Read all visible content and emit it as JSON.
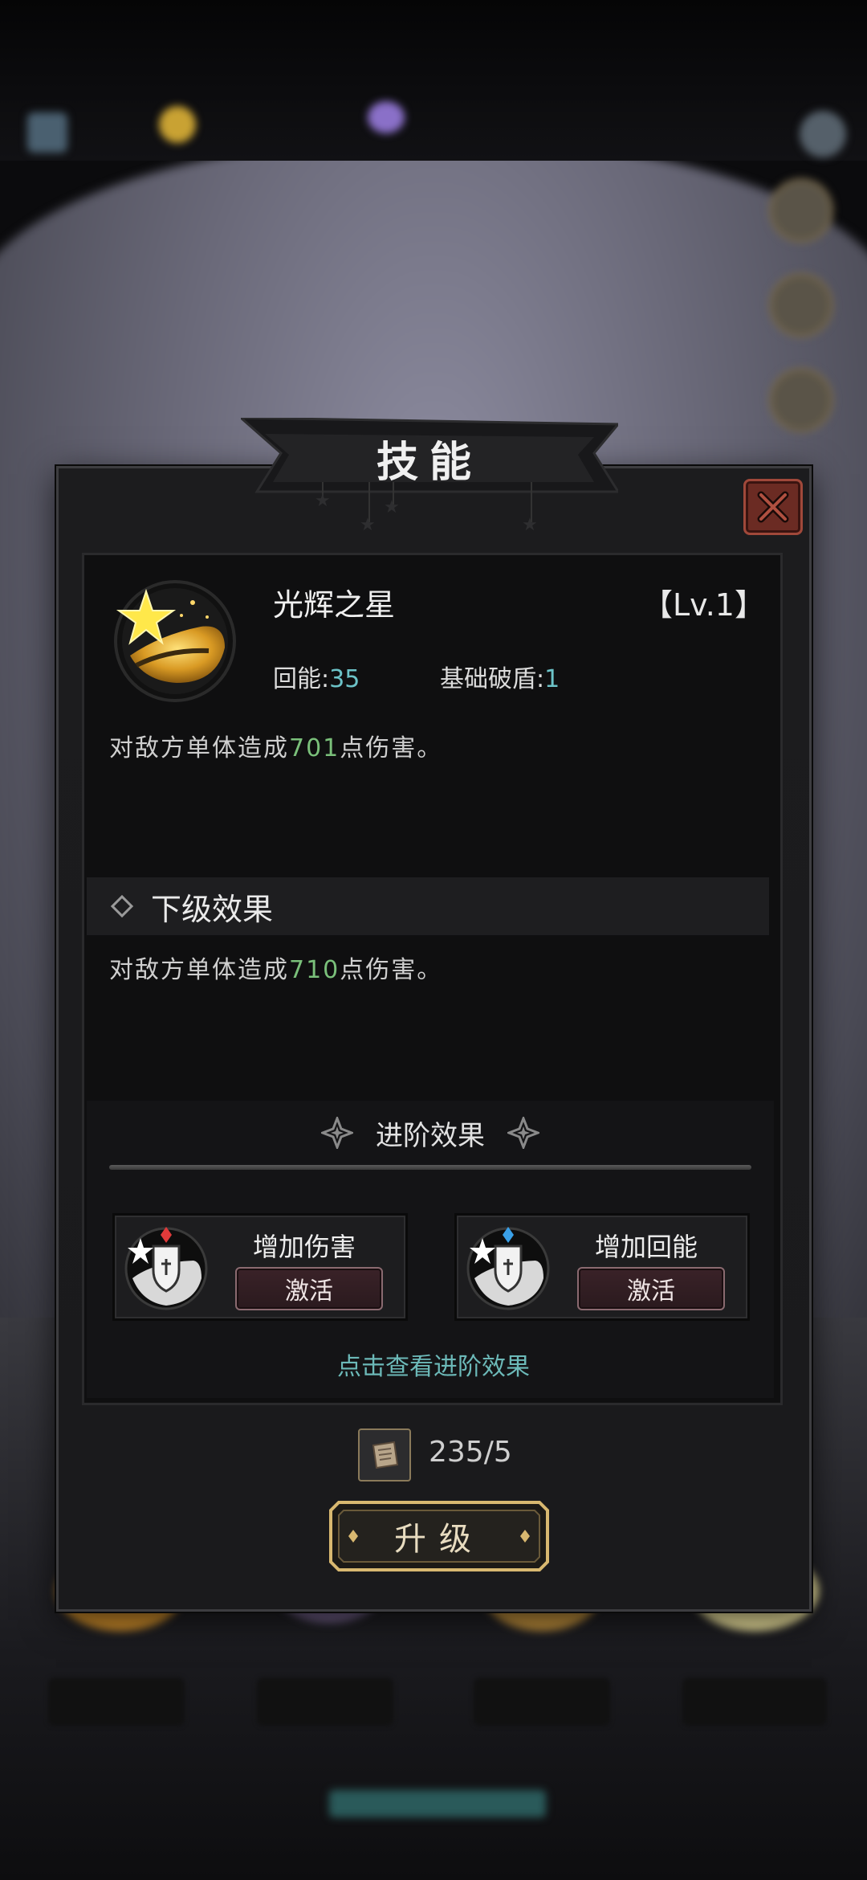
{
  "dialog": {
    "title": "技能",
    "skill": {
      "name": "光辉之星",
      "level": "【Lv.1】",
      "energy_label": "回能:",
      "energy_value": "35",
      "shield_label": "基础破盾:",
      "shield_value": "1",
      "desc_prefix": "对敌方单体造成",
      "desc_value": "701",
      "desc_suffix": "点伤害。"
    },
    "next_level": {
      "title": "下级效果",
      "desc_prefix": "对敌方单体造成",
      "desc_value": "710",
      "desc_suffix": "点伤害。"
    },
    "advanced": {
      "title": "进阶效果",
      "cards": [
        {
          "label": "增加伤害",
          "button": "激活",
          "gem_color": "#e03a3a"
        },
        {
          "label": "增加回能",
          "button": "激活",
          "gem_color": "#3aa0e8"
        }
      ],
      "view_link": "点击查看进阶效果"
    },
    "material_count": "235/5",
    "upgrade_label": "升级"
  },
  "colors": {
    "accent_teal": "#6cc3c8",
    "highlight_green": "#7ac07a",
    "close_red": "#6b2b23",
    "gold": "#d8b870"
  }
}
